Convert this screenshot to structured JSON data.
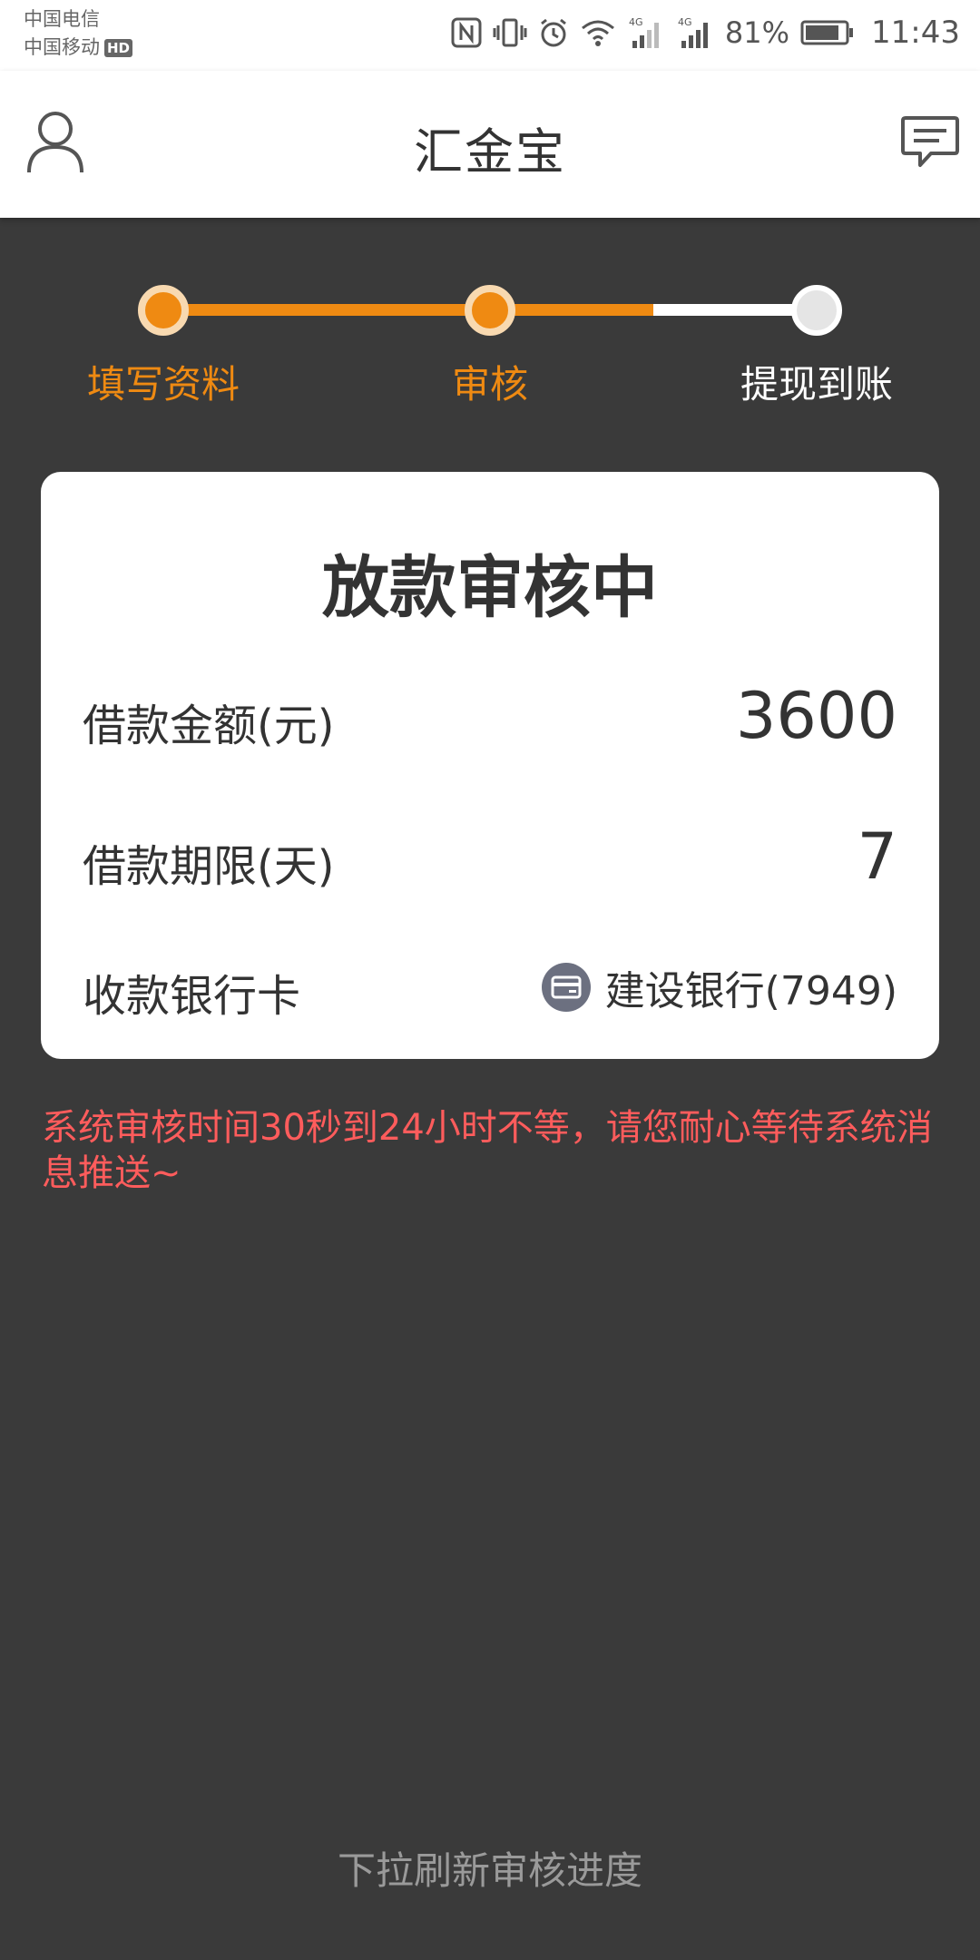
{
  "status_bar": {
    "carrier_1": "中国电信",
    "carrier_2": "中国移动",
    "hd_badge": "HD",
    "network_1": "4G",
    "network_2": "4G",
    "battery": "81%",
    "time": "11:43",
    "icons": [
      "nfc-icon",
      "vibrate-icon",
      "alarm-icon",
      "wifi-icon",
      "signal-icon",
      "battery-icon"
    ]
  },
  "app_bar": {
    "title": "汇金宝",
    "left_icon": "profile-icon",
    "right_icon": "message-icon"
  },
  "progress": {
    "steps": [
      {
        "label": "填写资料",
        "state": "done"
      },
      {
        "label": "审核",
        "state": "current"
      },
      {
        "label": "提现到账",
        "state": "pending"
      }
    ],
    "fill_fraction": 0.75,
    "colors": {
      "active": "#ef8a12",
      "inactive": "#ffffff"
    }
  },
  "status_card": {
    "title": "放款审核中",
    "rows": [
      {
        "label": "借款金额(元)",
        "value": "3600"
      },
      {
        "label": "借款期限(天)",
        "value": "7"
      },
      {
        "label": "收款银行卡",
        "value": "建设银行(7949)",
        "icon": "bank-card-icon"
      }
    ]
  },
  "notice": "系统审核时间30秒到24小时不等，请您耐心等待系统消息推送~",
  "notice_color": "#ff5c5c",
  "pull_hint": "下拉刷新审核进度"
}
